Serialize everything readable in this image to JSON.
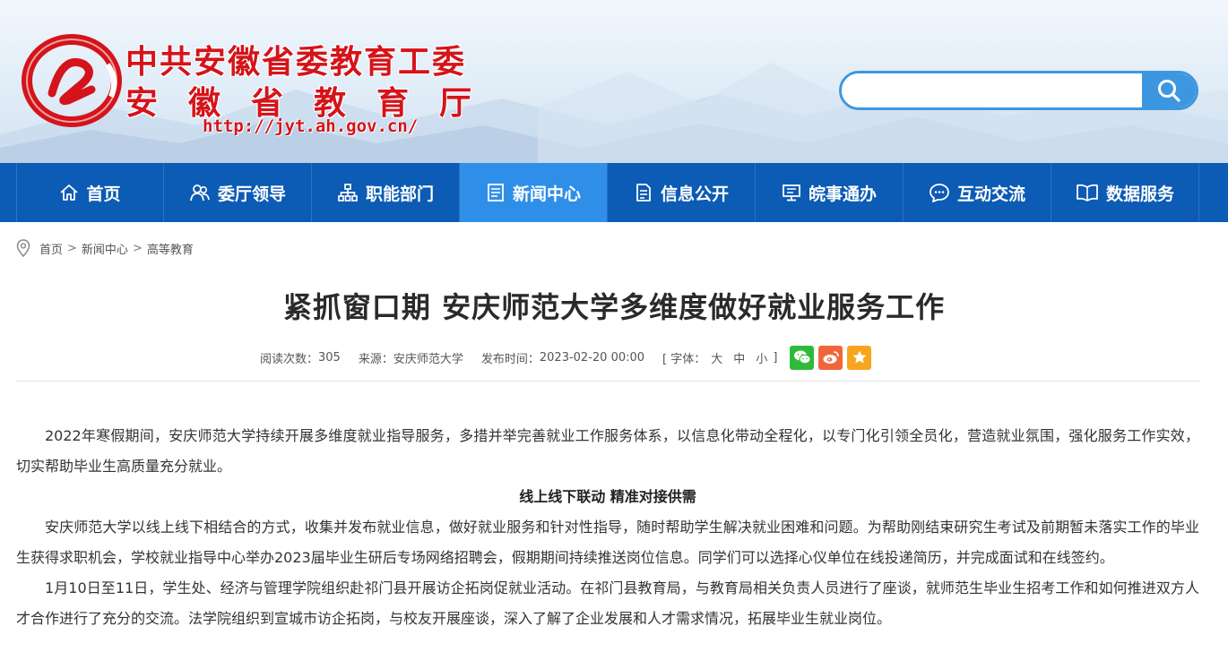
{
  "header": {
    "title_line1": "中共安徽省委教育工委",
    "title_line2": "安徽省教育厅",
    "url": "http://jyt.ah.gov.cn/",
    "search_placeholder": ""
  },
  "nav": [
    {
      "label": "首页",
      "icon": "home-icon",
      "active": false
    },
    {
      "label": "委厅领导",
      "icon": "leaders-icon",
      "active": false
    },
    {
      "label": "职能部门",
      "icon": "org-chart-icon",
      "active": false
    },
    {
      "label": "新闻中心",
      "icon": "news-icon",
      "active": true
    },
    {
      "label": "信息公开",
      "icon": "document-icon",
      "active": false
    },
    {
      "label": "皖事通办",
      "icon": "monitor-icon",
      "active": false
    },
    {
      "label": "互动交流",
      "icon": "chat-icon",
      "active": false
    },
    {
      "label": "数据服务",
      "icon": "book-icon",
      "active": false
    }
  ],
  "breadcrumb": [
    "首页",
    "新闻中心",
    "高等教育"
  ],
  "article": {
    "title": "紧抓窗口期 安庆师范大学多维度做好就业服务工作",
    "reads_label": "阅读次数：",
    "reads": "305",
    "source_label": "来源：",
    "source": "安庆师范大学",
    "published_label": "发布时间：",
    "published": "2023-02-20 00:00",
    "font_label_open": "[ 字体：",
    "font_large": "大",
    "font_medium": "中",
    "font_small": "小",
    "font_label_close": "]",
    "paragraphs": [
      "2022年寒假期间，安庆师范大学持续开展多维度就业指导服务，多措并举完善就业工作服务体系，以信息化带动全程化，以专门化引领全员化，营造就业氛围，强化服务工作实效，切实帮助毕业生高质量充分就业。",
      "安庆师范大学以线上线下相结合的方式，收集并发布就业信息，做好就业服务和针对性指导，随时帮助学生解决就业困难和问题。为帮助刚结束研究生考试及前期暂未落实工作的毕业生获得求职机会，学校就业指导中心举办2023届毕业生研后专场网络招聘会，假期期间持续推送岗位信息。同学们可以选择心仪单位在线投递简历，并完成面试和在线签约。",
      "1月10日至11日，学生处、经济与管理学院组织赴祁门县开展访企拓岗促就业活动。在祁门县教育局，与教育局相关负责人员进行了座谈，就师范生毕业生招考工作和如何推进双方人才合作进行了充分的交流。法学院组织到宣城市访企拓岗，与校友开展座谈，深入了解了企业发展和人才需求情况，拓展毕业生就业岗位。"
    ],
    "subheading": "线上线下联动 精准对接供需"
  },
  "colors": {
    "nav_bg": "#0c5bb4",
    "nav_active": "#2f8fe8",
    "brand_red": "#d4141a",
    "search_blue": "#3d97e0"
  }
}
